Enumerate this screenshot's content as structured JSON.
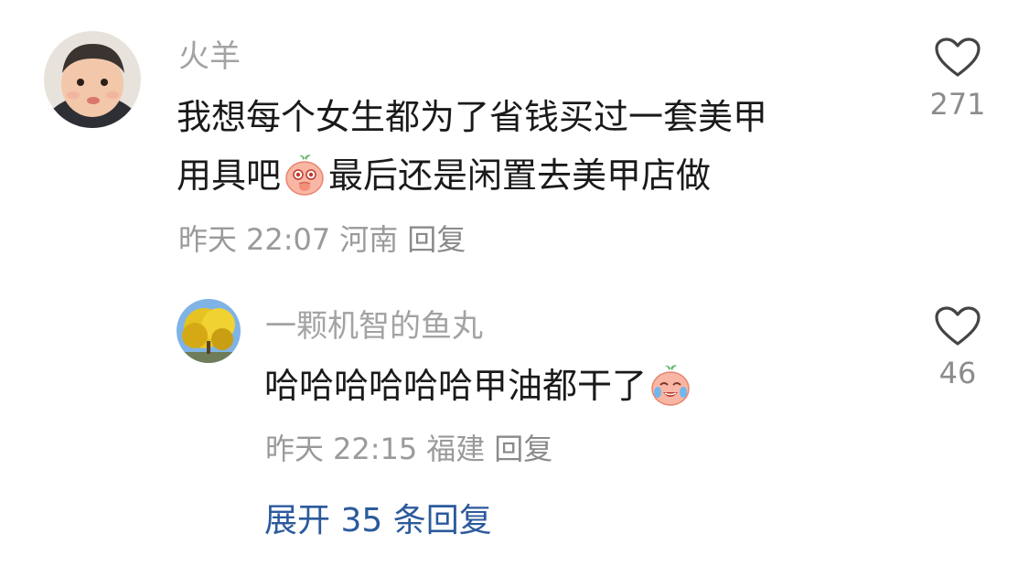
{
  "comments": [
    {
      "username": "火羊",
      "text_line1": "我想每个女生都为了省钱买过一套美甲",
      "text_line2_a": "用具吧",
      "emoji1": "shy-peach-emoji",
      "text_line2_b": "最后还是闲置去美甲店做",
      "date": "昨天",
      "time": "22:07",
      "location": "河南",
      "reply_label": "回复",
      "likes": "271"
    },
    {
      "username": "一颗机智的鱼丸",
      "text_a": "哈哈哈哈哈哈甲油都干了",
      "emoji1": "laughing-crying-peach-emoji",
      "date": "昨天",
      "time": "22:15",
      "location": "福建",
      "reply_label": "回复",
      "likes": "46"
    }
  ],
  "expand_replies_label": "展开 35 条回复",
  "icons": {
    "like": "heart-outline-icon"
  },
  "colors": {
    "username": "#a3a3a3",
    "meta": "#9a9a9a",
    "link": "#2b5a9c"
  }
}
